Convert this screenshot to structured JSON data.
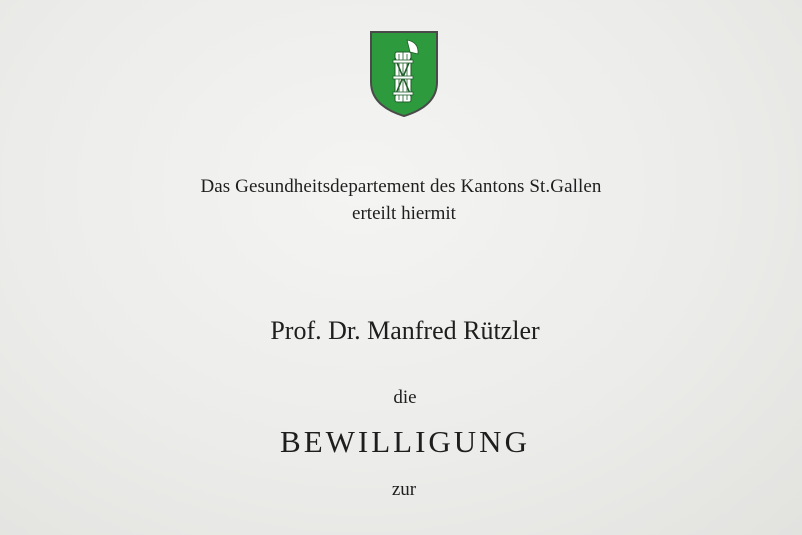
{
  "document": {
    "crest": {
      "icon": "st-gallen-coat-of-arms-icon",
      "colors": {
        "shield": "#2e9a3e",
        "border": "#4a4a4a",
        "emblem": "#ffffff"
      }
    },
    "issuer": "Das Gesundheitsdepartement des Kantons St.Gallen",
    "grant_phrase": "erteilt hiermit",
    "recipient": "Prof. Dr. Manfred Rützler",
    "article": "die",
    "title": "BEWILLIGUNG",
    "preposition": "zur"
  }
}
